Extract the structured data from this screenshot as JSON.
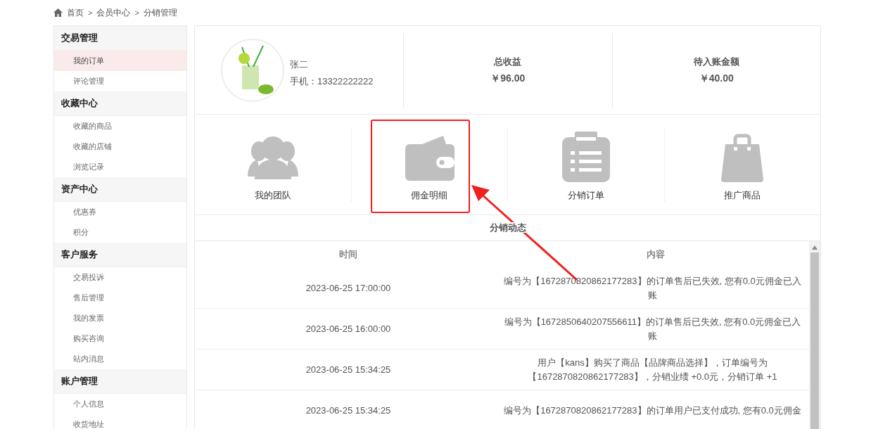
{
  "breadcrumb": {
    "separator": ">",
    "items": [
      "首页",
      "会员中心",
      "分销管理"
    ]
  },
  "sidebar": [
    {
      "title": "交易管理",
      "items": [
        {
          "label": "我的订单",
          "selected": true
        },
        {
          "label": "评论管理",
          "selected": false
        }
      ]
    },
    {
      "title": "收藏中心",
      "items": [
        {
          "label": "收藏的商品",
          "selected": false
        },
        {
          "label": "收藏的店铺",
          "selected": false
        },
        {
          "label": "浏览记录",
          "selected": false
        }
      ]
    },
    {
      "title": "资产中心",
      "items": [
        {
          "label": "优惠券",
          "selected": false
        },
        {
          "label": "积分",
          "selected": false
        }
      ]
    },
    {
      "title": "客户服务",
      "items": [
        {
          "label": "交易投诉",
          "selected": false
        },
        {
          "label": "售后管理",
          "selected": false
        },
        {
          "label": "我的发票",
          "selected": false
        },
        {
          "label": "购买咨询",
          "selected": false
        },
        {
          "label": "站内消息",
          "selected": false
        }
      ]
    },
    {
      "title": "账户管理",
      "items": [
        {
          "label": "个人信息",
          "selected": false
        },
        {
          "label": "收货地址",
          "selected": false
        }
      ]
    }
  ],
  "profile": {
    "name": "张二",
    "phone": "手机：13322222222"
  },
  "stats": [
    {
      "label": "总收益",
      "value": "￥96.00"
    },
    {
      "label": "待入账金额",
      "value": "￥40.00"
    }
  ],
  "shortcuts": [
    {
      "kind": "team",
      "label": "我的团队",
      "highlighted": false
    },
    {
      "kind": "wallet",
      "label": "佣金明细",
      "highlighted": true
    },
    {
      "kind": "orders",
      "label": "分销订单",
      "highlighted": false
    },
    {
      "kind": "bag",
      "label": "推广商品",
      "highlighted": false
    }
  ],
  "activity": {
    "title": "分销动态",
    "columns": [
      "时间",
      "内容"
    ],
    "rows": [
      {
        "time": "2023-06-25 17:00:00",
        "content": "编号为【1672870820862177283】的订单售后已失效, 您有0.0元佣金已入账"
      },
      {
        "time": "2023-06-25 16:00:00",
        "content": "编号为【1672850640207556611】的订单售后已失效, 您有0.0元佣金已入账"
      },
      {
        "time": "2023-06-25 15:34:25",
        "content": "用户【kans】购买了商品【品牌商品选择】，订单编号为【1672870820862177283】，分销业绩 +0.0元，分销订单 +1"
      },
      {
        "time": "2023-06-25 15:34:25",
        "content": "编号为【1672870820862177283】的订单用户已支付成功, 您有0.0元佣金"
      }
    ]
  }
}
